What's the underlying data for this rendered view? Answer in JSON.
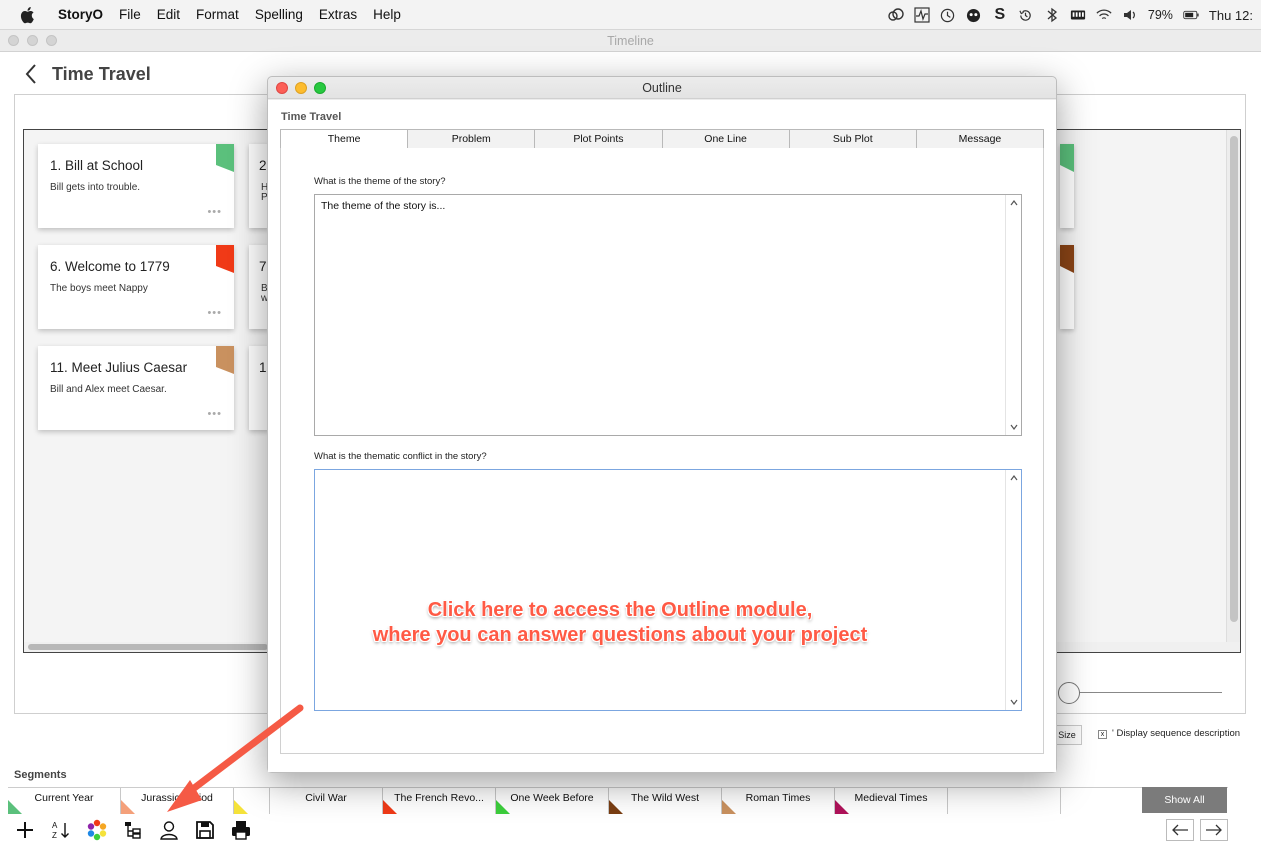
{
  "menubar": {
    "app_name": "StoryO",
    "items": [
      "File",
      "Edit",
      "Format",
      "Spelling",
      "Extras",
      "Help"
    ],
    "battery": "79%",
    "clock": "Thu 12:"
  },
  "window": {
    "title": "Timeline"
  },
  "project": {
    "title": "Time Travel"
  },
  "cards": [
    {
      "title": "1. Bill at School",
      "desc": "Bill gets into trouble.",
      "flag": "#5bc07c"
    },
    {
      "title": "6. Welcome to 1779",
      "desc": "The boys meet Nappy",
      "flag": "#f03a17"
    },
    {
      "title": "11. Meet Julius Caesar",
      "desc": "Bill and Alex meet Caesar.",
      "flag": "#c9915f"
    }
  ],
  "partial_cards": [
    {
      "title": "2.",
      "desc": "H",
      "desc2": "P"
    },
    {
      "title": "7.",
      "desc": "B",
      "desc2": "w"
    },
    {
      "title": "1:",
      "desc": "",
      "desc2": ""
    }
  ],
  "right_flags": [
    "#5bc07c",
    "#8a4416"
  ],
  "card_more": "•••",
  "size_button": "Size",
  "display_sequence": {
    "checked_mark": "x",
    "label": "' Display sequence description"
  },
  "segments": {
    "label": "Segments",
    "items": [
      {
        "name": "Current Year",
        "flag": "#5bc07c"
      },
      {
        "name": "Jurassic Period",
        "flag": "#f4a07a"
      },
      {
        "name": "",
        "flag": "#f5e23a"
      },
      {
        "name": "Civil War",
        "flag": ""
      },
      {
        "name": "The French Revo...",
        "flag": "#f03a17"
      },
      {
        "name": "One Week Before",
        "flag": "#3ccf3c"
      },
      {
        "name": "The Wild West",
        "flag": "#7a3e12"
      },
      {
        "name": "Roman Times",
        "flag": "#c9915f"
      },
      {
        "name": "Medieval Times",
        "flag": "#b0125a"
      },
      {
        "name": "",
        "flag": ""
      }
    ],
    "show_all": "Show All"
  },
  "outline": {
    "title": "Outline",
    "project": "Time Travel",
    "tabs": [
      "Theme",
      "Problem",
      "Plot Points",
      "One Line",
      "Sub Plot",
      "Message"
    ],
    "active_tab": "Theme",
    "q1": "What is the theme of the story?",
    "a1": "The theme of the story is...",
    "q2": "What is the thematic conflict in the story?",
    "a2": ""
  },
  "annotation": {
    "line1": "Click here to access the Outline module,",
    "line2": "where you can answer questions about your project",
    "color": "#ff5a45"
  }
}
